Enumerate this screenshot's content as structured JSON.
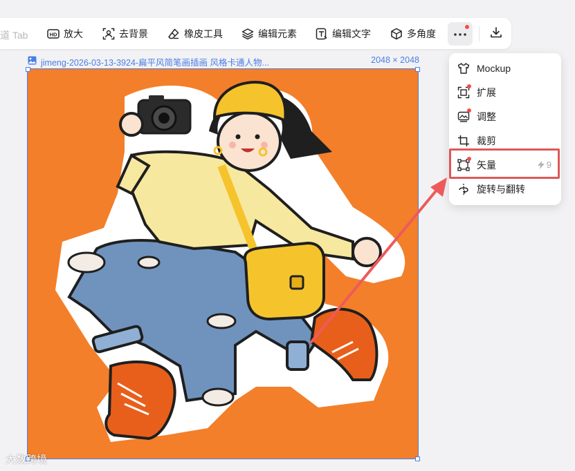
{
  "toolbar": {
    "tab_hint": "道 Tab",
    "tools": [
      {
        "label": "放大",
        "icon": "hd-icon"
      },
      {
        "label": "去背景",
        "icon": "remove-bg-icon"
      },
      {
        "label": "橡皮工具",
        "icon": "eraser-icon"
      },
      {
        "label": "编辑元素",
        "icon": "layers-icon"
      },
      {
        "label": "编辑文字",
        "icon": "edit-text-icon"
      },
      {
        "label": "多角度",
        "icon": "cube-icon"
      }
    ],
    "more_icon": "more-dots-icon",
    "download_icon": "download-icon"
  },
  "file": {
    "name": "jimeng-2026-03-13-3924-扁平风简笔画插画 风格卡通人物...",
    "size": "2048 × 2048"
  },
  "menu": {
    "items": [
      {
        "label": "Mockup",
        "icon": "tshirt-icon",
        "dot": false,
        "cost": ""
      },
      {
        "label": "扩展",
        "icon": "expand-icon",
        "dot": true,
        "cost": ""
      },
      {
        "label": "调整",
        "icon": "adjust-icon",
        "dot": true,
        "cost": ""
      },
      {
        "label": "裁剪",
        "icon": "crop-icon",
        "dot": false,
        "cost": ""
      },
      {
        "label": "矢量",
        "icon": "vector-icon",
        "dot": true,
        "cost": "9"
      },
      {
        "label": "旋转与翻转",
        "icon": "rotate-flip-icon",
        "dot": false,
        "cost": ""
      }
    ]
  },
  "watermark": "大数跨境",
  "colors": {
    "accent": "#4a7ee6",
    "highlight": "#e15757",
    "illustration_bg": "#f37f2a"
  }
}
